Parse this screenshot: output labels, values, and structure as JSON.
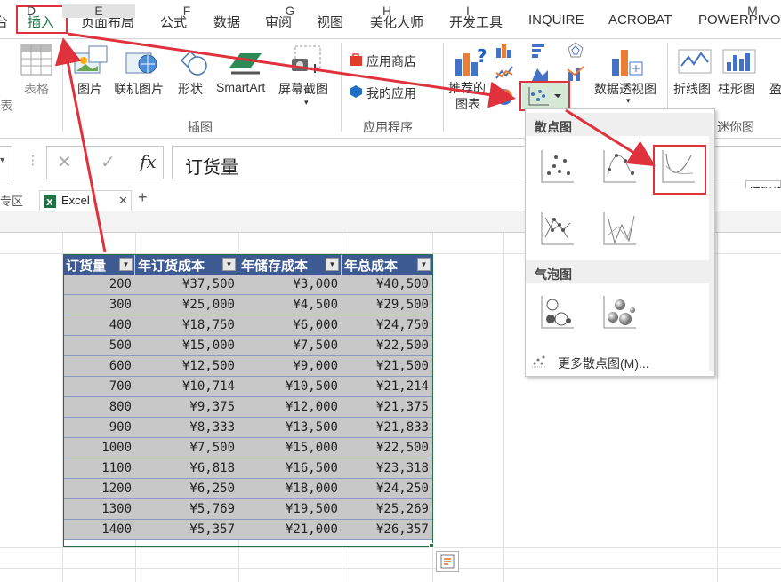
{
  "tabs": {
    "partial_left": "台",
    "items": [
      "插入",
      "页面布局",
      "公式",
      "数据",
      "审阅",
      "视图",
      "美化大师",
      "开发工具",
      "INQUIRE",
      "ACROBAT",
      "POWERPIVOT"
    ]
  },
  "ribbon": {
    "partial_left_label": "表",
    "table_label": "表格",
    "picture_label": "图片",
    "online_picture_label": "联机图片",
    "shapes_label": "形状",
    "smartart_label": "SmartArt",
    "screenshot_label": "屏幕截图",
    "app_store_label": "应用商店",
    "my_apps_label": "我的应用",
    "recommended_charts_line1": "推荐的",
    "recommended_charts_line2": "图表",
    "pivot_chart_label": "数据透视图",
    "line_spark_label": "折线图",
    "column_spark_label": "柱形图",
    "winloss_partial": "盈",
    "group_illustrations": "插图",
    "group_apps": "应用程序",
    "group_sparklines": "迷你图"
  },
  "formula_bar": {
    "cancel_icon": "✕",
    "enter_icon": "✓",
    "fx_label": "fx",
    "value": "订货量"
  },
  "workbook_tabs": {
    "partial_left": "专区",
    "excel_tab": "Excel",
    "close": "✕",
    "add": "+"
  },
  "columns": [
    "D",
    "E",
    "F",
    "G",
    "H",
    "I",
    "M"
  ],
  "table": {
    "headers": [
      "订货量",
      "年订货成本",
      "年储存成本",
      "年总成本"
    ],
    "rows": [
      [
        "200",
        "¥37,500",
        "¥3,000",
        "¥40,500"
      ],
      [
        "300",
        "¥25,000",
        "¥4,500",
        "¥29,500"
      ],
      [
        "400",
        "¥18,750",
        "¥6,000",
        "¥24,750"
      ],
      [
        "500",
        "¥15,000",
        "¥7,500",
        "¥22,500"
      ],
      [
        "600",
        "¥12,500",
        "¥9,000",
        "¥21,500"
      ],
      [
        "700",
        "¥10,714",
        "¥10,500",
        "¥21,214"
      ],
      [
        "800",
        "¥9,375",
        "¥12,000",
        "¥21,375"
      ],
      [
        "900",
        "¥8,333",
        "¥13,500",
        "¥21,833"
      ],
      [
        "1000",
        "¥7,500",
        "¥15,000",
        "¥22,500"
      ],
      [
        "1100",
        "¥6,818",
        "¥16,500",
        "¥23,318"
      ],
      [
        "1200",
        "¥6,250",
        "¥18,000",
        "¥24,250"
      ],
      [
        "1300",
        "¥5,769",
        "¥19,500",
        "¥25,269"
      ],
      [
        "1400",
        "¥5,357",
        "¥21,000",
        "¥26,357"
      ]
    ]
  },
  "scatter_menu": {
    "section_scatter": "散点图",
    "section_bubble": "气泡图",
    "more_label": "更多散点图(M)..."
  },
  "tooltip": "编辑格",
  "colors": {
    "accent": "#217346",
    "table_header": "#3d5a93",
    "table_row": "#c8c8c8",
    "highlight": "#e0323c"
  }
}
